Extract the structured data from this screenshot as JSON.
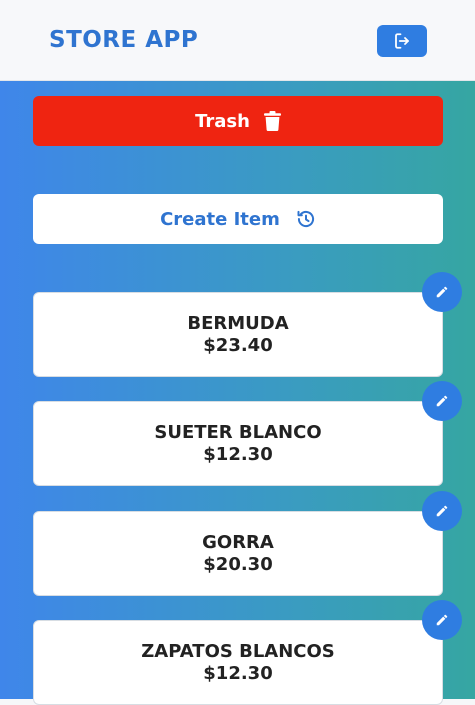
{
  "header": {
    "title": "STORE APP",
    "logout_icon": "logout-icon"
  },
  "actions": {
    "trash_label": "Trash",
    "trash_icon": "trash-icon",
    "create_label": "Create Item",
    "create_icon": "history-icon"
  },
  "items": [
    {
      "name": "BERMUDA",
      "price": "$23.40"
    },
    {
      "name": "SUETER BLANCO",
      "price": "$12.30"
    },
    {
      "name": "GORRA",
      "price": "$20.30"
    },
    {
      "name": "ZAPATOS BLANCOS",
      "price": "$12.30"
    }
  ],
  "edit_icon": "pencil-icon",
  "colors": {
    "brand": "#2f74d0",
    "button": "#2f7de1",
    "danger": "#ef2411",
    "gradient_start": "#3f86ea",
    "gradient_end": "#36a6a2"
  }
}
